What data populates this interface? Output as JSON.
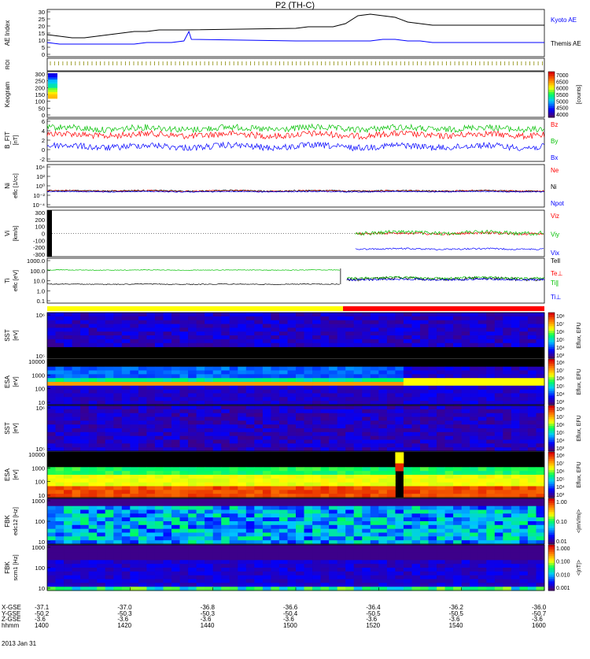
{
  "title": "P2 (TH-C)",
  "footer": {
    "rows": [
      {
        "label": "X-GSE",
        "values": [
          "-37.1",
          "-37.0",
          "-36.8",
          "-36.6",
          "-36.4",
          "-36.2",
          "-36.0"
        ]
      },
      {
        "label": "Y-GSE",
        "values": [
          "-50.2",
          "-50.3",
          "-50.3",
          "-50.4",
          "-50.5",
          "-50.5",
          "-50.7"
        ]
      },
      {
        "label": "Z-GSE",
        "values": [
          "-3.6",
          "-3.6",
          "-3.6",
          "-3.6",
          "-3.6",
          "-3.6",
          "-3.6"
        ]
      },
      {
        "label": "hhmm",
        "values": [
          "1400",
          "1420",
          "1440",
          "1500",
          "1520",
          "1540",
          "1600"
        ]
      }
    ],
    "date": "2013 Jan 31"
  },
  "chart_data": [
    {
      "type": "line",
      "ylabel": "AE Index",
      "yticks": [
        "30",
        "25",
        "20",
        "15",
        "10",
        "5",
        "0"
      ],
      "ylim": [
        0,
        30
      ],
      "series": [
        {
          "name": "Kyoto AE",
          "color": "#000000",
          "x": [
            1400,
            1405,
            1410,
            1415,
            1420,
            1425,
            1430,
            1435,
            1440,
            1445,
            1450,
            1455,
            1500,
            1505,
            1510,
            1515,
            1520,
            1525,
            1530,
            1535,
            1540,
            1545,
            1550,
            1555,
            1600
          ],
          "y": [
            14,
            13,
            12,
            12,
            13,
            14,
            15,
            16,
            16,
            17,
            17,
            17,
            18,
            19,
            19,
            19,
            21,
            26,
            27,
            26,
            25,
            22,
            21,
            20,
            20
          ]
        },
        {
          "name": "Themis AE",
          "color": "#0000ff",
          "x": [
            1400,
            1405,
            1410,
            1415,
            1420,
            1425,
            1430,
            1435,
            1440,
            1445,
            1450,
            1455,
            1456,
            1457,
            1458,
            1500,
            1505,
            1510,
            1515,
            1520,
            1525,
            1530,
            1535,
            1540,
            1545,
            1550,
            1555,
            1600
          ],
          "y": [
            9,
            8,
            8,
            8,
            8,
            8,
            8,
            8,
            9,
            9,
            9,
            10,
            13,
            16,
            11,
            10,
            10,
            10,
            10,
            10,
            10,
            10,
            11,
            11,
            10,
            10,
            9,
            9
          ]
        }
      ]
    },
    {
      "type": "table",
      "ylabel": "ROI"
    },
    {
      "type": "heatmap",
      "ylabel": "Keogram",
      "yticks": [
        "300",
        "250",
        "200",
        "150",
        "100",
        "50",
        "0"
      ],
      "colorbar": {
        "ticks": [
          "7000",
          "6500",
          "6000",
          "5500",
          "5000",
          "4500",
          "4000"
        ],
        "label": "[counts]"
      }
    },
    {
      "type": "line",
      "ylabel": "B_FIT",
      "yunit": "[nT]",
      "yticks": [
        "6",
        "4",
        "2",
        "0",
        "-2"
      ],
      "ylim": [
        -2,
        6
      ],
      "series": [
        {
          "name": "Bz",
          "color": "#ff0000",
          "y": [
            3.0
          ]
        },
        {
          "name": "By",
          "color": "#00c000",
          "y": [
            4.2
          ]
        },
        {
          "name": "Bx",
          "color": "#0000ff",
          "y": [
            0.8
          ]
        }
      ]
    },
    {
      "type": "line",
      "ylabel": "Ni",
      "yunit": "eflc [1/cc]",
      "yticks": [
        "10⁴",
        "10²",
        "10⁰",
        "10⁻²",
        "10⁻⁴"
      ],
      "series": [
        {
          "name": "Ne",
          "color": "#ff0000"
        },
        {
          "name": "Ni",
          "color": "#000000"
        },
        {
          "name": "Npot",
          "color": "#0000ff"
        }
      ]
    },
    {
      "type": "line",
      "ylabel": "Vi",
      "yunit": "[km/s]",
      "yticks": [
        "300",
        "200",
        "100",
        "0",
        "-100",
        "-200",
        "-300"
      ],
      "ylim": [
        -300,
        300
      ],
      "series": [
        {
          "name": "Viz",
          "color": "#ff0000"
        },
        {
          "name": "Viy",
          "color": "#00c000"
        },
        {
          "name": "Vix",
          "color": "#0000ff"
        }
      ]
    },
    {
      "type": "line",
      "ylabel": "Ti",
      "yunit": "eflc [eV]",
      "yticks": [
        "1000.0",
        "100.0",
        "10.0",
        "1.0",
        "0.1"
      ],
      "series": [
        {
          "name": "Tell",
          "color": "#000000"
        },
        {
          "name": "Te⊥",
          "color": "#ff0000"
        },
        {
          "name": "Ti∥",
          "color": "#00c000"
        },
        {
          "name": "Ti⊥",
          "color": "#0000ff"
        }
      ]
    },
    {
      "type": "heatmap",
      "ylabel": "SST",
      "yunit": "[eV]",
      "yticks": [
        "10⁶",
        "10⁵"
      ],
      "colorbar": {
        "ticks": [
          "10⁸",
          "10⁷",
          "10⁶",
          "10⁵",
          "10⁴",
          "10³"
        ],
        "label": "Eflux, EFU"
      }
    },
    {
      "type": "heatmap",
      "ylabel": "ESA",
      "yunit": "[eV]",
      "yticks": [
        "10000",
        "1000",
        "100",
        "10"
      ],
      "colorbar": {
        "ticks": [
          "10⁸",
          "10⁷",
          "10⁶",
          "10⁵",
          "10⁴",
          "10³"
        ],
        "label": "Eflux, EFU"
      }
    },
    {
      "type": "heatmap",
      "ylabel": "SST",
      "yunit": "[eV]",
      "yticks": [
        "10⁶",
        "10⁵"
      ],
      "colorbar": {
        "ticks": [
          "10⁸",
          "10⁷",
          "10⁶",
          "10⁵",
          "10⁴",
          "10³"
        ],
        "label": "Eflux, EFU"
      }
    },
    {
      "type": "heatmap",
      "ylabel": "ESA",
      "yunit": "[eV]",
      "yticks": [
        "10000",
        "1000",
        "100",
        "10"
      ],
      "colorbar": {
        "ticks": [
          "10⁸",
          "10⁷",
          "10⁶",
          "10⁵",
          "10⁴",
          "10³"
        ],
        "label": "Eflux, EFU"
      }
    },
    {
      "type": "heatmap",
      "ylabel": "FBK",
      "yunit": "edc12 [Hz]",
      "yticks": [
        "1000",
        "100",
        "10"
      ],
      "colorbar": {
        "ticks": [
          "1.00",
          "0.10",
          "0.01"
        ],
        "label": "<|mV/m|>"
      }
    },
    {
      "type": "heatmap",
      "ylabel": "FBK",
      "yunit": "scm1 [Hz]",
      "yticks": [
        "1000",
        "100",
        "10"
      ],
      "colorbar": {
        "ticks": [
          "1.000",
          "0.100",
          "0.010",
          "0.001"
        ],
        "label": "<|nT|>"
      }
    }
  ],
  "colors": {
    "kyoto": "#000000",
    "themis": "#0000ff",
    "red": "#ff0000",
    "green": "#00c000",
    "blue": "#0000ff",
    "yellow": "#ffff00"
  }
}
